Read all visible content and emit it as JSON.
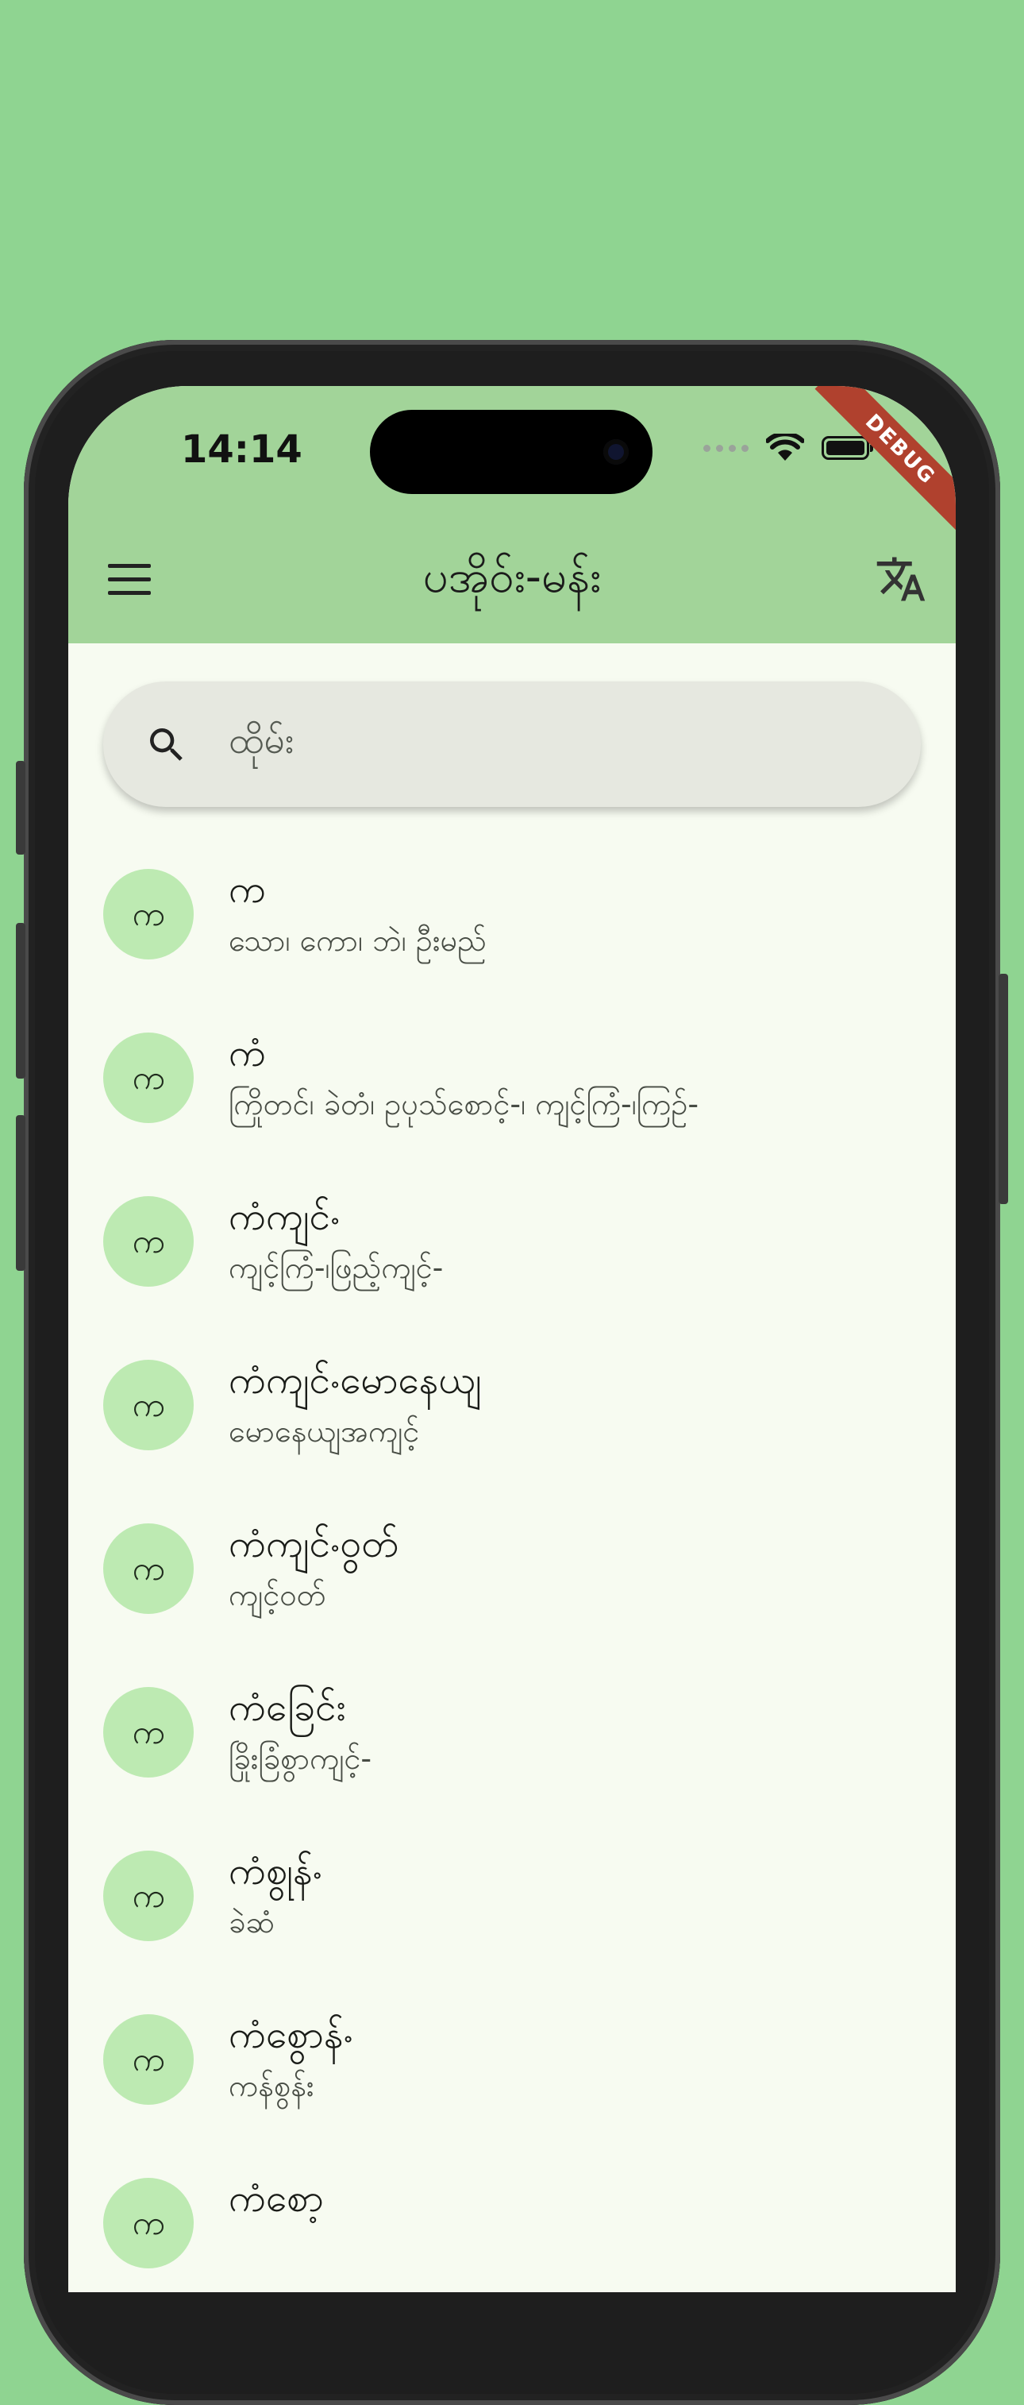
{
  "status_bar": {
    "time": "14:14"
  },
  "debug_banner": "DEBUG",
  "app_bar": {
    "title": "ပအိုဝ်း-မန်း",
    "menu_icon": "menu-icon",
    "translate_icon": "translate-icon"
  },
  "search": {
    "placeholder": "ထိုမ်း",
    "icon": "search-icon"
  },
  "entries": [
    {
      "letter": "က",
      "word": "က",
      "meaning": "သော၊ ကော၊ ဘဲ၊ ဦးမည်"
    },
    {
      "letter": "က",
      "word": "ကံ",
      "meaning": "ကြိုတင်၊ ခဲတံ၊ ဥပုသ်စောင့်-၊ ကျင့်ကြံ-၊ကြဉ်-"
    },
    {
      "letter": "က",
      "word": "ကံကျင်ႋ",
      "meaning": "ကျင့်ကြံ-၊ဖြည့်ကျင့်-"
    },
    {
      "letter": "က",
      "word": "ကံကျင်ႋမောနေယျ",
      "meaning": "မောနေယျအကျင့်"
    },
    {
      "letter": "က",
      "word": "ကံကျင်ႋဝွတ်",
      "meaning": "ကျင့်ဝတ်"
    },
    {
      "letter": "က",
      "word": "ကံခြေင်း",
      "meaning": "ခြိုးခြံစွာကျင့်-"
    },
    {
      "letter": "က",
      "word": "ကံစွုန်ႋ",
      "meaning": "ခဲဆံ"
    },
    {
      "letter": "က",
      "word": "ကံစွောန်ႋ",
      "meaning": "ကန်စွန်း"
    },
    {
      "letter": "က",
      "word": "ကံစော့",
      "meaning": ""
    }
  ]
}
